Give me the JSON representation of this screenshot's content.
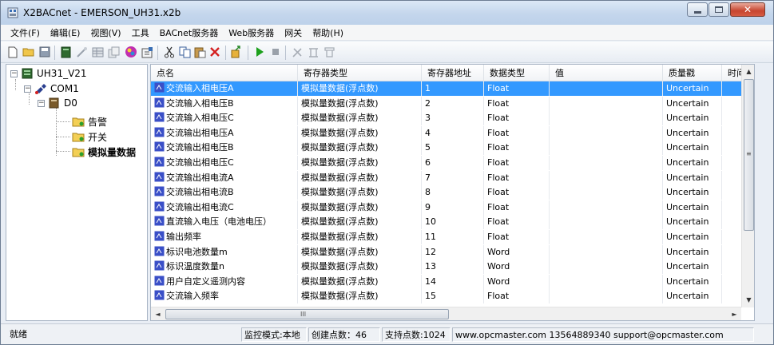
{
  "window": {
    "title": "X2BACnet - EMERSON_UH31.x2b",
    "close_glyph": "✕"
  },
  "menu": [
    "文件(F)",
    "编辑(E)",
    "视图(V)",
    "工具",
    "BACnet服务器",
    "Web服务器",
    "网关",
    "帮助(H)"
  ],
  "toolbar": {
    "icons": [
      "new-file-icon",
      "open-folder-icon",
      "save-icon",
      "device-icon",
      "wand-icon",
      "table-icon",
      "copy-doc-icon",
      "color-icon",
      "properties-icon",
      "cut-icon",
      "copy-icon",
      "paste-icon",
      "delete-icon",
      "export-icon",
      "run-icon",
      "stop-icon",
      "tool1-icon",
      "tool2-icon",
      "tool3-icon"
    ]
  },
  "tree": {
    "root": "UH31_V21",
    "port": "COM1",
    "device": "D0",
    "groups": [
      "告警",
      "开关",
      "模拟量数据"
    ],
    "expander_minus": "−"
  },
  "grid": {
    "columns": [
      "点名",
      "寄存器类型",
      "寄存器地址",
      "数据类型",
      "值",
      "质量戳",
      "时间"
    ],
    "rows": [
      [
        "交流输入相电压A",
        "模拟量数据(浮点数)",
        "1",
        "Float",
        "",
        "Uncertain"
      ],
      [
        "交流输入相电压B",
        "模拟量数据(浮点数)",
        "2",
        "Float",
        "",
        "Uncertain"
      ],
      [
        "交流输入相电压C",
        "模拟量数据(浮点数)",
        "3",
        "Float",
        "",
        "Uncertain"
      ],
      [
        "交流输出相电压A",
        "模拟量数据(浮点数)",
        "4",
        "Float",
        "",
        "Uncertain"
      ],
      [
        "交流输出相电压B",
        "模拟量数据(浮点数)",
        "5",
        "Float",
        "",
        "Uncertain"
      ],
      [
        "交流输出相电压C",
        "模拟量数据(浮点数)",
        "6",
        "Float",
        "",
        "Uncertain"
      ],
      [
        "交流输出相电流A",
        "模拟量数据(浮点数)",
        "7",
        "Float",
        "",
        "Uncertain"
      ],
      [
        "交流输出相电流B",
        "模拟量数据(浮点数)",
        "8",
        "Float",
        "",
        "Uncertain"
      ],
      [
        "交流输出相电流C",
        "模拟量数据(浮点数)",
        "9",
        "Float",
        "",
        "Uncertain"
      ],
      [
        "直流输入电压（电池电压）",
        "模拟量数据(浮点数)",
        "10",
        "Float",
        "",
        "Uncertain"
      ],
      [
        "输出频率",
        "模拟量数据(浮点数)",
        "11",
        "Float",
        "",
        "Uncertain"
      ],
      [
        "标识电池数量m",
        "模拟量数据(浮点数)",
        "12",
        "Word",
        "",
        "Uncertain"
      ],
      [
        "标识温度数量n",
        "模拟量数据(浮点数)",
        "13",
        "Word",
        "",
        "Uncertain"
      ],
      [
        "用户自定义遥测内容",
        "模拟量数据(浮点数)",
        "14",
        "Word",
        "",
        "Uncertain"
      ],
      [
        "交流输入频率",
        "模拟量数据(浮点数)",
        "15",
        "Float",
        "",
        "Uncertain"
      ]
    ],
    "selected_row": 0,
    "scroll": {
      "up": "▲",
      "down": "▼",
      "left": "◄",
      "right": "►",
      "grip_v": "≡",
      "grip_h": "III"
    }
  },
  "status": {
    "ready": "就绪",
    "mode": "监控模式:本地",
    "created_points": "创建点数：46",
    "supported_points": "支持点数:1024",
    "contact": "www.opcmaster.com 13564889340 support@opcmaster.com"
  },
  "colors": {
    "selection": "#3399ff",
    "row_icon": "#3a4fc7"
  }
}
